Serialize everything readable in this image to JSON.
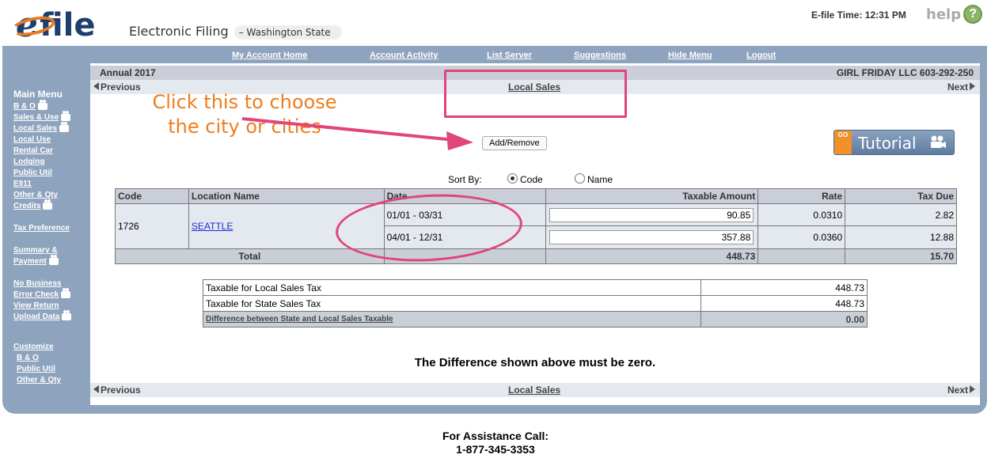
{
  "header": {
    "logo_file": "file",
    "logo_subtitle": "Electronic Filing",
    "logo_state": "– Washington State",
    "efile_time": "E-file Time: 12:31 PM",
    "help_label": "help"
  },
  "topnav": [
    "My Account Home",
    "Account Activity",
    "List Server",
    "Suggestions",
    "Hide Menu",
    "Logout"
  ],
  "sidebar": {
    "title": "Main Menu",
    "items": [
      "B & O",
      "Sales & Use",
      "Local Sales",
      "Local Use",
      "Rental Car",
      "Lodging",
      "Public Util",
      "E911",
      "Other & Qty",
      "Credits"
    ],
    "tax_preference": "Tax Preference",
    "summary": "Summary &",
    "payment": "Payment",
    "no_business": "No Business",
    "error_check": "Error Check",
    "view_return": "View Return",
    "upload_data": "Upload Data",
    "customize": "Customize",
    "customize_items": [
      "B & O",
      "Public Util",
      "Other & Qty"
    ]
  },
  "content": {
    "period": "Annual 2017",
    "account": "GIRL FRIDAY LLC 603-292-250",
    "previous": "Previous",
    "next": "Next",
    "section_title": "Local Sales",
    "annotation": "Click this to choose the city or cities",
    "add_remove": "Add/Remove",
    "tutorial_go": "GO",
    "tutorial": "Tutorial",
    "sort_by": "Sort By:",
    "sort_code": "Code",
    "sort_name": "Name",
    "sort_selected": "Code",
    "zero_message": "The Difference shown above must be zero."
  },
  "table": {
    "headers": [
      "Code",
      "Location Name",
      "Date",
      "Taxable Amount",
      "Rate",
      "Tax Due"
    ],
    "code": "1726",
    "location": "SEATTLE",
    "rows": [
      {
        "date": "01/01 - 03/31",
        "amount": "90.85",
        "rate": "0.0310",
        "tax_due": "2.82"
      },
      {
        "date": "04/01 - 12/31",
        "amount": "357.88",
        "rate": "0.0360",
        "tax_due": "12.88"
      }
    ],
    "total_label": "Total",
    "total_amount": "448.73",
    "total_tax": "15.70"
  },
  "summary": {
    "local_label": "Taxable for Local Sales Tax",
    "local_value": "448.73",
    "state_label": "Taxable for State Sales Tax",
    "state_value": "448.73",
    "diff_label": "Difference between State and Local Sales Taxable",
    "diff_value": "0.00"
  },
  "footer": {
    "assist_label": "For Assistance Call:",
    "phone": "1-877-345-3353"
  },
  "colors": {
    "brand_navy": "#1d3f6e",
    "brand_orange": "#e87a22",
    "frame_blue": "#8ea3bd",
    "annotation_pink": "#e0457b",
    "annotation_orange": "#f07c1b"
  }
}
